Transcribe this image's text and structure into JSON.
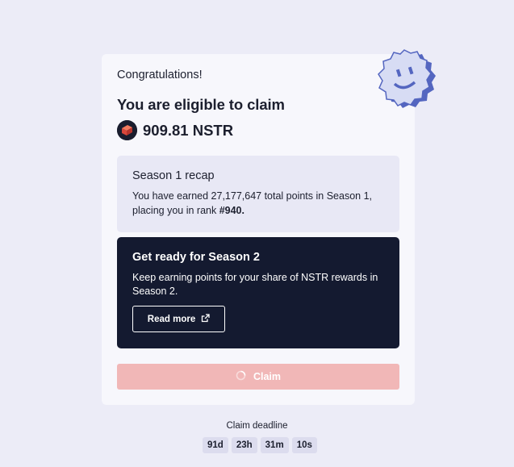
{
  "card": {
    "congrats": "Congratulations!",
    "eligible_title": "You are eligible to claim",
    "amount": "909.81 NSTR",
    "token_icon": "nstr-token-icon"
  },
  "recap": {
    "title": "Season 1 recap",
    "text_prefix": "You have earned 27,177,647 total points in Season 1, placing you in rank ",
    "rank": "#940."
  },
  "season2": {
    "title": "Get ready for Season 2",
    "text": "Keep earning points for your share of NSTR rewards in Season 2.",
    "read_more_label": "Read more",
    "read_more_icon": "external-link-icon"
  },
  "claim": {
    "label": "Claim",
    "icon": "spinner-icon"
  },
  "deadline": {
    "label": "Claim deadline",
    "chips": [
      "91d",
      "23h",
      "31m",
      "10s"
    ]
  },
  "colors": {
    "background": "#ececf7",
    "card": "#f7f7fc",
    "recap_bg": "#e8e8f5",
    "season2_bg": "#141a30",
    "claim_bg": "#f1b7b7",
    "token_accent": "#e8584a",
    "mascot_blue": "#5466c0"
  }
}
